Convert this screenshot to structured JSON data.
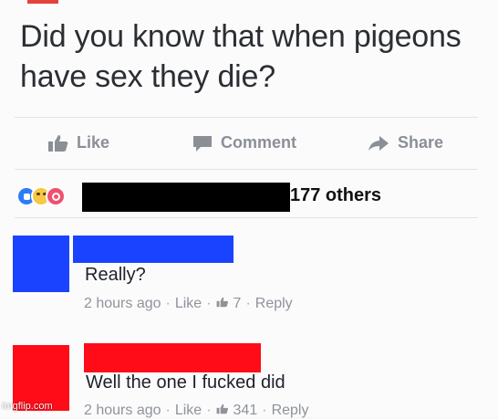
{
  "post": {
    "text": "Did you know that when pigeons have sex they die?"
  },
  "actions": {
    "like_label": "Like",
    "comment_label": "Comment",
    "share_label": "Share"
  },
  "reactions": {
    "others_text": "177 others",
    "icons": [
      "like-reaction-icon",
      "haha-reaction-icon",
      "love-reaction-icon"
    ]
  },
  "colors": {
    "redaction_black": "#000000",
    "redaction_blue": "#1a43ff",
    "redaction_red": "#ff0c18",
    "meta_gray": "#8f939a"
  },
  "comments": [
    {
      "text": "Really?",
      "time": "2 hours ago",
      "like_label": "Like",
      "like_count": "7",
      "reply_label": "Reply"
    },
    {
      "text": "Well the one I fucked did",
      "time": "2 hours ago",
      "like_label": "Like",
      "like_count": "341",
      "reply_label": "Reply"
    }
  ],
  "watermark": "imgflip.com"
}
